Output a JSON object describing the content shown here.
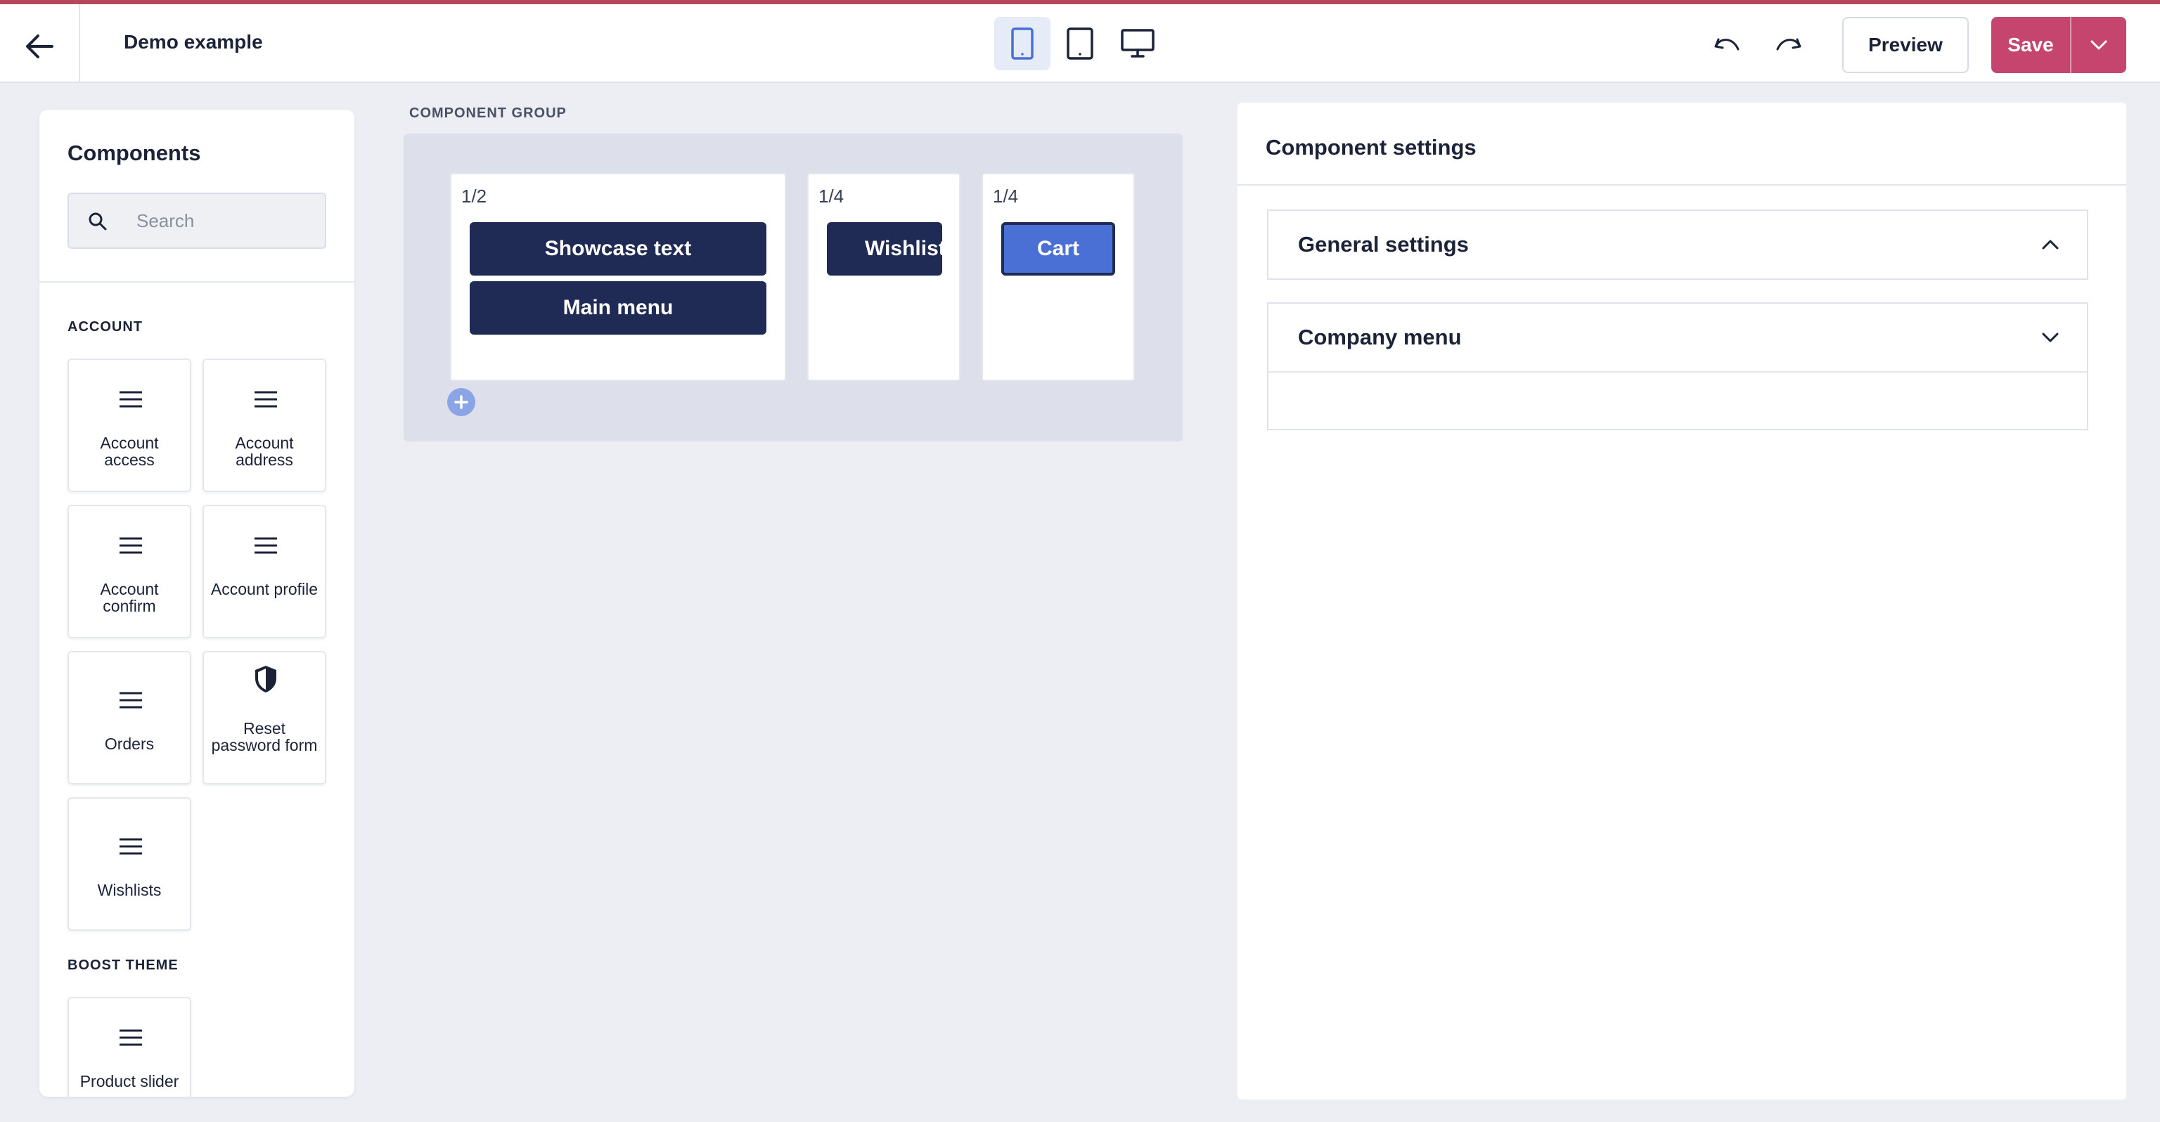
{
  "header": {
    "title": "Demo example",
    "devices": [
      "mobile",
      "tablet",
      "desktop"
    ],
    "active_device": "mobile",
    "preview_label": "Preview",
    "save_label": "Save"
  },
  "colors": {
    "accent": "#c5456e",
    "navy": "#1f2b55",
    "selected": "#4a70d6"
  },
  "components_panel": {
    "title": "Components",
    "search_placeholder": "Search",
    "sections": [
      {
        "label": "ACCOUNT",
        "items": [
          {
            "label": "Account access",
            "icon": "list-icon"
          },
          {
            "label": "Account address",
            "icon": "list-icon"
          },
          {
            "label": "Account confirm",
            "icon": "list-icon"
          },
          {
            "label": "Account profile",
            "icon": "list-icon"
          },
          {
            "label": "Orders",
            "icon": "list-icon"
          },
          {
            "label": "Reset password form",
            "icon": "shield-icon"
          },
          {
            "label": "Wishlists",
            "icon": "list-icon"
          }
        ]
      },
      {
        "label": "BOOST THEME",
        "items": [
          {
            "label": "Product slider",
            "icon": "list-icon"
          }
        ]
      }
    ]
  },
  "canvas": {
    "group_label": "COMPONENT GROUP",
    "columns": [
      {
        "fraction": "1/2",
        "blocks": [
          "Showcase text",
          "Main menu"
        ]
      },
      {
        "fraction": "1/4",
        "blocks": [
          "Wishlists"
        ]
      },
      {
        "fraction": "1/4",
        "blocks": [
          "Cart"
        ],
        "selected": "Cart"
      }
    ]
  },
  "settings_panel": {
    "title": "Component settings",
    "sections": [
      {
        "title": "General settings",
        "expanded": true
      },
      {
        "title": "Company menu",
        "expanded": false
      }
    ]
  }
}
